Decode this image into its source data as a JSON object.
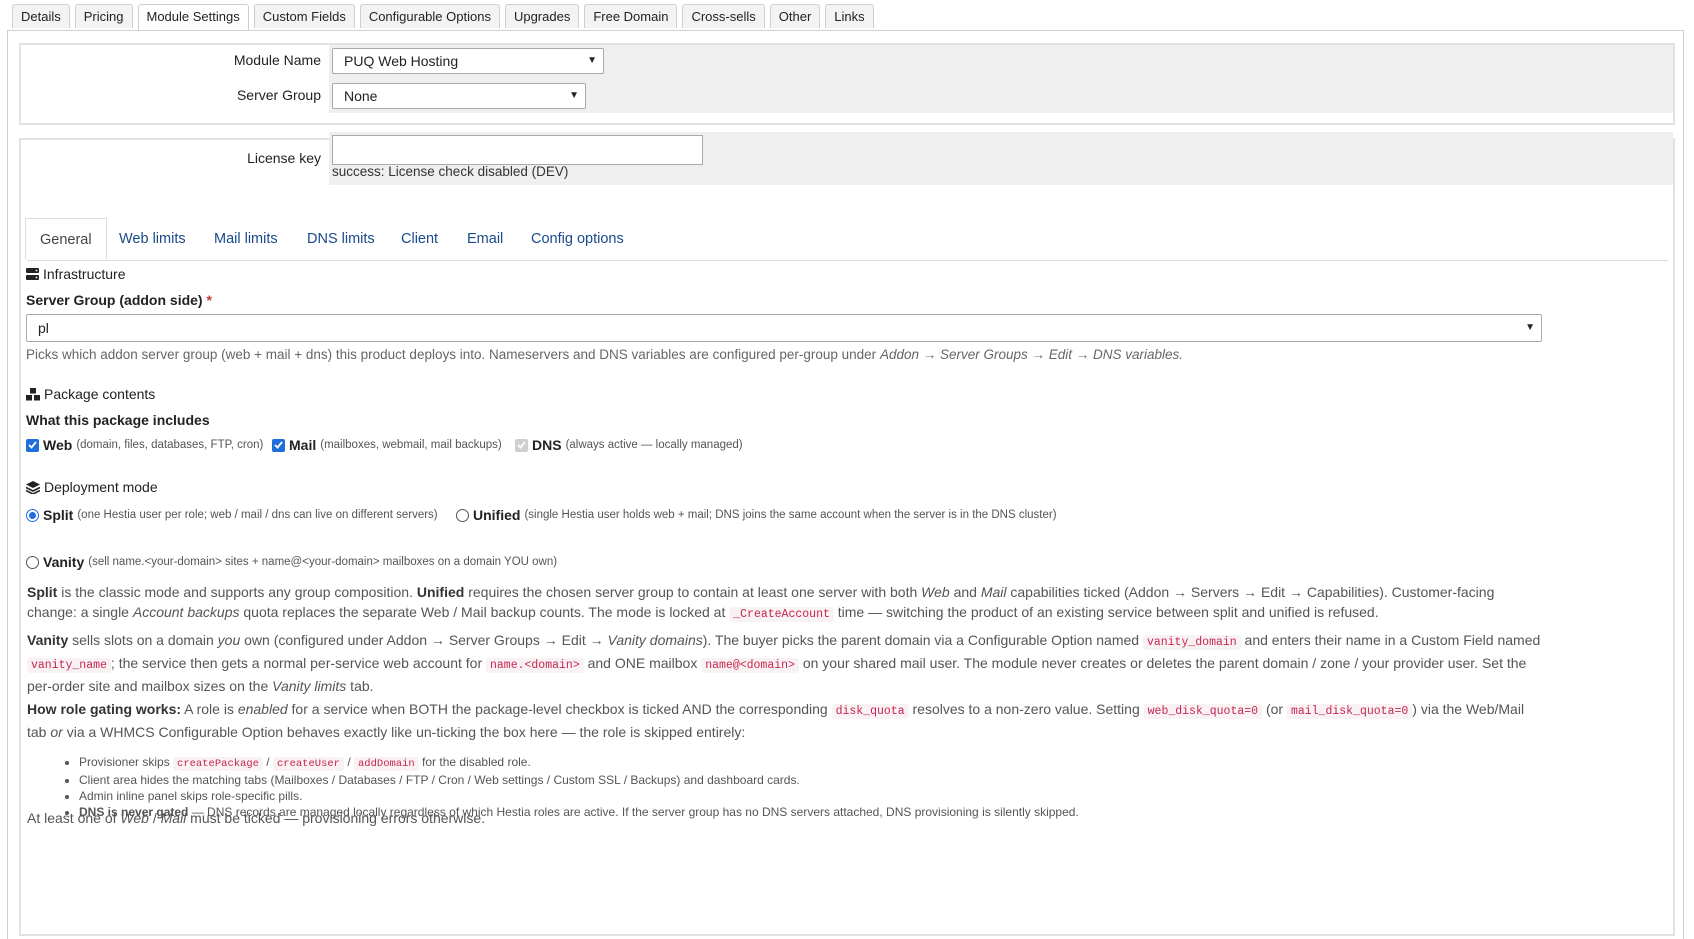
{
  "top_tabs": [
    "Details",
    "Pricing",
    "Module Settings",
    "Custom Fields",
    "Configurable Options",
    "Upgrades",
    "Free Domain",
    "Cross-sells",
    "Other",
    "Links"
  ],
  "module": {
    "module_name_label": "Module Name",
    "module_name_value": "PUQ Web Hosting",
    "server_group_label": "Server Group",
    "server_group_value": "None"
  },
  "license": {
    "label": "License key",
    "value": "",
    "status": "success: License check disabled (DEV)"
  },
  "inner_tabs": [
    "General",
    "Web limits",
    "Mail limits",
    "DNS limits",
    "Client",
    "Email",
    "Config options"
  ],
  "infra": {
    "heading": "Infrastructure",
    "server_group_label": "Server Group (addon side)",
    "required_mark": "*",
    "server_group_value": "pl",
    "help_prefix": "Picks which addon server group (web + mail + dns) this product deploys into. Nameservers and DNS variables are configured per-group under ",
    "help_path": "Addon → Server Groups → Edit → DNS variables."
  },
  "package": {
    "heading": "Package contents",
    "includes_label": "What this package includes",
    "web": {
      "label": "Web",
      "hint": "(domain, files, databases, FTP, cron)",
      "checked": true
    },
    "mail": {
      "label": "Mail",
      "hint": "(mailboxes, webmail, mail backups)",
      "checked": true
    },
    "dns": {
      "label": "DNS",
      "hint": "(always active — locally managed)",
      "checked": true,
      "disabled": true
    }
  },
  "deployment": {
    "heading": "Deployment mode",
    "split": {
      "label": "Split",
      "hint": "(one Hestia user per role; web / mail / dns can live on different servers)",
      "selected": true
    },
    "unified": {
      "label": "Unified",
      "hint": "(single Hestia user holds web + mail; DNS joins the same account when the server is in the DNS cluster)",
      "selected": false
    },
    "vanity": {
      "label": "Vanity",
      "hint": "(sell name.<your-domain> sites + name@<your-domain> mailboxes on a domain YOU own)",
      "selected": false
    }
  },
  "para_split": {
    "b1": "Split",
    "t1": " is the classic mode and supports any group composition. ",
    "b2": "Unified",
    "t2": " requires the chosen server group to contain at least one server with both ",
    "i1": "Web",
    "t3": " and ",
    "i2": "Mail",
    "t4": " capabilities ticked (Addon → Servers → Edit → Capabilities). Customer-facing change: a single ",
    "i3": "Account backups",
    "t5": " quota replaces the separate Web / Mail backup counts. The mode is locked at ",
    "c1": "_CreateAccount",
    "t6": " time — switching the product of an existing service between split and unified is refused."
  },
  "para_vanity": {
    "b1": "Vanity",
    "t1": " sells slots on a domain ",
    "i1": "you",
    "t2": " own (configured under Addon → Server Groups → Edit → ",
    "i2": "Vanity domains",
    "t3": "). The buyer picks the parent domain via a Configurable Option named ",
    "c1": "vanity_domain",
    "t4": " and enters their name in a Custom Field named ",
    "c2": "vanity_name",
    "t5": "; the service then gets a normal per-service web account for ",
    "c3": "name.<domain>",
    "t6": " and ONE mailbox ",
    "c4": "name@<domain>",
    "t7": " on your shared mail user. The module never creates or deletes the parent domain / zone / your provider user. Set the per-order site and mailbox sizes on the ",
    "i3": "Vanity limits",
    "t8": " tab."
  },
  "para_gating": {
    "b1": "How role gating works:",
    "t1": " A role is ",
    "i1": "enabled",
    "t2": " for a service when BOTH the package-level checkbox is ticked AND the corresponding ",
    "c1": "disk_quota",
    "t3": " resolves to a non-zero value. Setting ",
    "c2": "web_disk_quota=0",
    "t4": " (or ",
    "c3": "mail_disk_quota=0",
    "t5": ") via the Web/Mail tab ",
    "i2": "or",
    "t6": " via a WHMCS Configurable Option behaves exactly like un-ticking the box here — the role is skipped entirely:"
  },
  "gating_list": {
    "li1_t1": "Provisioner skips ",
    "li1_c1": "createPackage",
    "li1_s1": " / ",
    "li1_c2": "createUser",
    "li1_s2": " / ",
    "li1_c3": "addDomain",
    "li1_t2": " for the disabled role.",
    "li2": "Client area hides the matching tabs (Mailboxes / Databases / FTP / Cron / Web settings / Custom SSL / Backups) and dashboard cards.",
    "li3": "Admin inline panel skips role-specific pills.",
    "li4_b": "DNS is never gated",
    "li4_t": " — DNS records are managed locally regardless of which Hestia roles are active. If the server group has no DNS servers attached, DNS provisioning is silently skipped."
  },
  "footer_note": {
    "t1": "At least one of ",
    "i1": "Web",
    "t2": " / ",
    "i2": "Mail",
    "t3": " must be ticked — provisioning errors otherwise."
  },
  "colors": {
    "accent": "#1e6fd9",
    "link": "#1a4a8a",
    "code": "#c7254e"
  }
}
